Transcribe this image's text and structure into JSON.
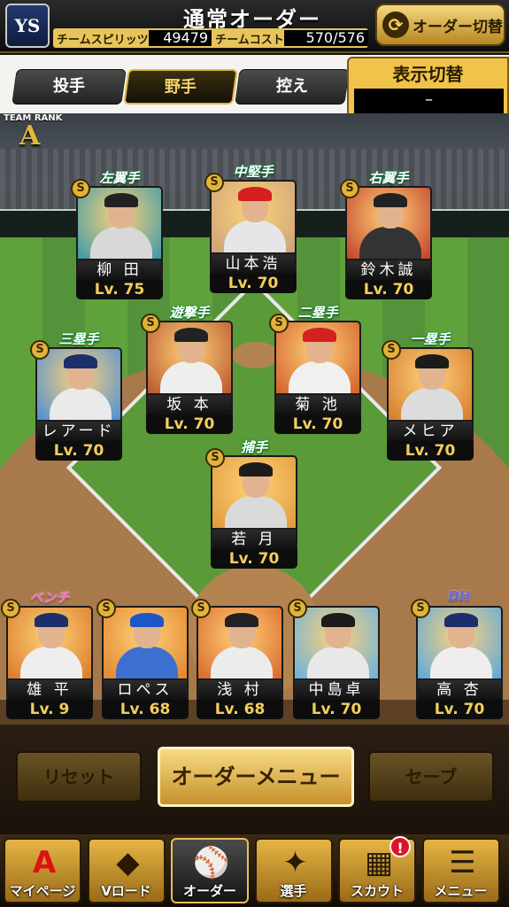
{
  "header": {
    "team_logo": "YS",
    "title": "通常オーダー",
    "team_spirit_label": "チームスピリッツ",
    "team_spirit_value": "49479",
    "team_cost_label": "チームコスト",
    "team_cost_value": "570/576",
    "order_switch_label": "オーダー切替"
  },
  "tabs": [
    {
      "label": "投手",
      "active": false
    },
    {
      "label": "野手",
      "active": true
    },
    {
      "label": "控え",
      "active": false
    }
  ],
  "display_switch": {
    "label": "表示切替",
    "value": "–"
  },
  "team_rank": {
    "label": "TEAM RANK",
    "value": "A"
  },
  "fielders": [
    {
      "position": "左翼手",
      "name": "柳 田",
      "level": "Lv. 75",
      "cap": "#222",
      "uniform": "#d8d8d8",
      "bg": "#3a9aa8"
    },
    {
      "position": "中堅手",
      "name": "山本浩",
      "level": "Lv. 70",
      "cap": "#d42020",
      "uniform": "#e6e6e6",
      "bg": "#caa27a"
    },
    {
      "position": "右翼手",
      "name": "鈴木誠",
      "level": "Lv. 70",
      "cap": "#222",
      "uniform": "#333",
      "bg": "#c2402a"
    },
    {
      "position": "遊撃手",
      "name": "坂 本",
      "level": "Lv. 70",
      "cap": "#222",
      "uniform": "#eee",
      "bg": "#b8562c"
    },
    {
      "position": "二塁手",
      "name": "菊 池",
      "level": "Lv. 70",
      "cap": "#d42020",
      "uniform": "#f0f0f0",
      "bg": "#d25f2a"
    },
    {
      "position": "三塁手",
      "name": "レアード",
      "level": "Lv. 70",
      "cap": "#1d2f6a",
      "uniform": "#eaeaea",
      "bg": "#4a8fd6"
    },
    {
      "position": "一塁手",
      "name": "メヒア",
      "level": "Lv. 70",
      "cap": "#1b1b1b",
      "uniform": "#dcdcdc",
      "bg": "#d57a2a"
    },
    {
      "position": "捕手",
      "name": "若 月",
      "level": "Lv. 70",
      "cap": "#1b1b1b",
      "uniform": "#dadada",
      "bg": "#e09a3a"
    }
  ],
  "bench_label": "ベンチ",
  "bench": [
    {
      "name": "雄 平",
      "level": "Lv. 9",
      "cap": "#1d2f6a",
      "uniform": "#eee",
      "bg": "#d9792a"
    },
    {
      "name": "ロペス",
      "level": "Lv. 68",
      "cap": "#1f56c6",
      "uniform": "#3b6fd0",
      "bg": "#e0842c"
    },
    {
      "name": "浅 村",
      "level": "Lv. 68",
      "cap": "#222",
      "uniform": "#ececec",
      "bg": "#d9672a"
    },
    {
      "name": "中島卓",
      "level": "Lv. 70",
      "cap": "#1b1b1b",
      "uniform": "#e8e8e8",
      "bg": "#6ab2dc"
    }
  ],
  "dh": {
    "position": "DH",
    "name": "高 杏",
    "level": "Lv. 70",
    "cap": "#1d2f6a",
    "uniform": "#eeeeee",
    "bg": "#5aa8e0"
  },
  "controls": {
    "reset": "リセット",
    "order_menu": "オーダーメニュー",
    "save": "セーブ"
  },
  "nav": [
    {
      "label": "マイページ",
      "icon": "A"
    },
    {
      "label": "Vロード",
      "icon": "◆"
    },
    {
      "label": "オーダー",
      "icon": "⚾"
    },
    {
      "label": "選手",
      "icon": "✦"
    },
    {
      "label": "スカウト",
      "icon": "▦",
      "badge": "!"
    },
    {
      "label": "メニュー",
      "icon": "☰"
    }
  ]
}
